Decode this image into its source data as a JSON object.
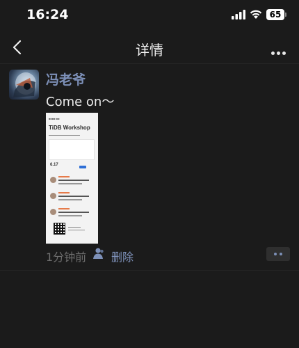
{
  "status_bar": {
    "time": "16:24",
    "battery": "65",
    "icons": [
      "signal-icon",
      "wifi-icon",
      "battery-icon"
    ]
  },
  "nav": {
    "title": "详情",
    "back_icon": "chevron-left-icon",
    "more_icon": "more-horizontal-icon"
  },
  "post": {
    "username": "冯老爷",
    "text": "Come on～",
    "image": {
      "title": "TiDB Workshop",
      "date": "6.17"
    },
    "time_ago": "1分钟前",
    "visibility_icon": "user-icon",
    "delete_label": "删除",
    "action_icon": "more-dots-icon"
  },
  "colors": {
    "background": "#1b1b1b",
    "username": "#7d90b8",
    "meta_text": "#6e6e6e"
  }
}
